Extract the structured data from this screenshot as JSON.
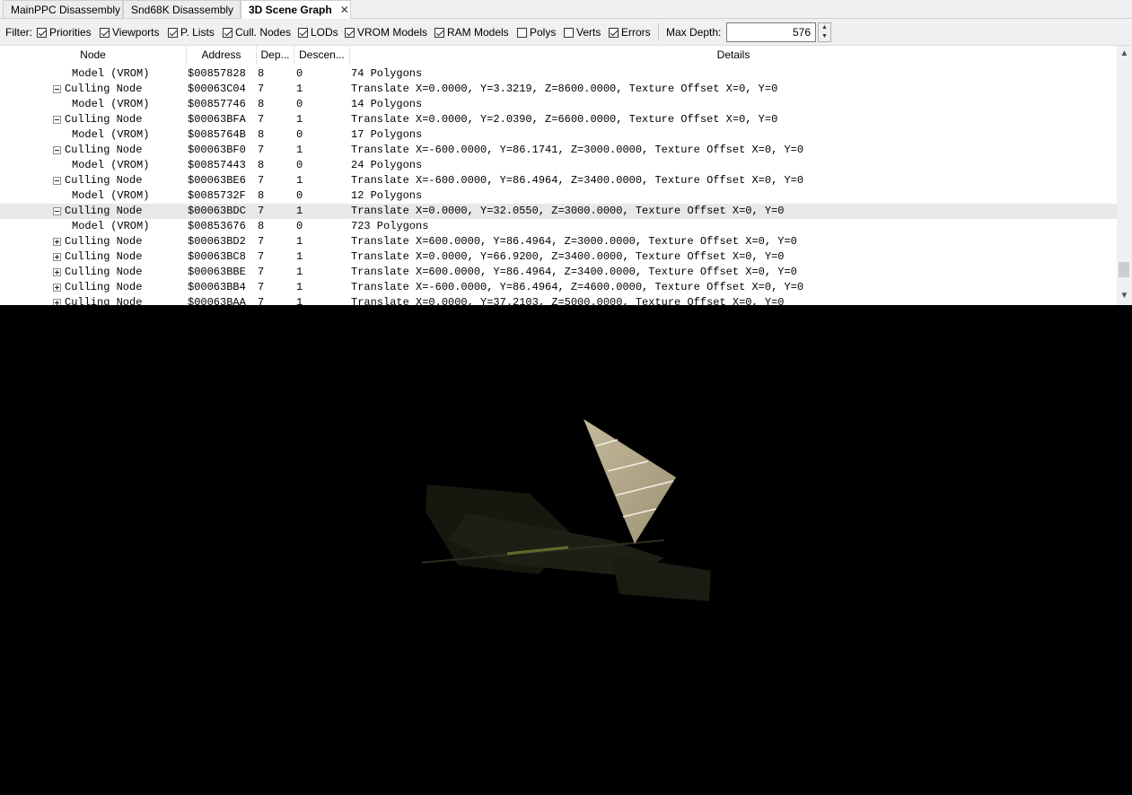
{
  "tabs": [
    {
      "label": "MainPPC Disassembly"
    },
    {
      "label": "Snd68K Disassembly"
    },
    {
      "label": "3D Scene Graph",
      "close": "✕"
    }
  ],
  "filter": {
    "label": "Filter:",
    "checks": [
      {
        "label": "Priorities",
        "checked": true
      },
      {
        "label": "Viewports",
        "checked": true
      },
      {
        "label": "P. Lists",
        "checked": true
      },
      {
        "label": "Cull. Nodes",
        "checked": true
      },
      {
        "label": "LODs",
        "checked": true
      },
      {
        "label": "VROM Models",
        "checked": true
      },
      {
        "label": "RAM Models",
        "checked": true
      },
      {
        "label": "Polys",
        "checked": false
      },
      {
        "label": "Verts",
        "checked": false
      },
      {
        "label": "Errors",
        "checked": true
      }
    ],
    "max_depth_label": "Max Depth:",
    "max_depth_value": "576"
  },
  "tree": {
    "columns": [
      "Node",
      "Address",
      "Dep...",
      "Descen...",
      "Details"
    ],
    "rows": [
      {
        "node": "Model (VROM)",
        "address": "$00857828",
        "depth": "8",
        "desc": "0",
        "details": "74 Polygons"
      },
      {
        "node": "Culling Node",
        "address": "$00063C04",
        "depth": "7",
        "desc": "1",
        "details": "Translate X=0.0000, Y=3.3219, Z=8600.0000, Texture Offset X=0, Y=0"
      },
      {
        "node": "Model (VROM)",
        "address": "$00857746",
        "depth": "8",
        "desc": "0",
        "details": "14 Polygons"
      },
      {
        "node": "Culling Node",
        "address": "$00063BFA",
        "depth": "7",
        "desc": "1",
        "details": "Translate X=0.0000, Y=2.0390, Z=6600.0000, Texture Offset X=0, Y=0"
      },
      {
        "node": "Model (VROM)",
        "address": "$0085764B",
        "depth": "8",
        "desc": "0",
        "details": "17 Polygons"
      },
      {
        "node": "Culling Node",
        "address": "$00063BF0",
        "depth": "7",
        "desc": "1",
        "details": "Translate X=-600.0000, Y=86.1741, Z=3000.0000, Texture Offset X=0, Y=0"
      },
      {
        "node": "Model (VROM)",
        "address": "$00857443",
        "depth": "8",
        "desc": "0",
        "details": "24 Polygons"
      },
      {
        "node": "Culling Node",
        "address": "$00063BE6",
        "depth": "7",
        "desc": "1",
        "details": "Translate X=-600.0000, Y=86.4964, Z=3400.0000, Texture Offset X=0, Y=0"
      },
      {
        "node": "Model (VROM)",
        "address": "$0085732F",
        "depth": "8",
        "desc": "0",
        "details": "12 Polygons"
      },
      {
        "node": "Culling Node",
        "address": "$00063BDC",
        "depth": "7",
        "desc": "1",
        "details": "Translate X=0.0000, Y=32.0550, Z=3000.0000, Texture Offset X=0, Y=0",
        "selected": true
      },
      {
        "node": "Model (VROM)",
        "address": "$00853676",
        "depth": "8",
        "desc": "0",
        "details": "723 Polygons"
      },
      {
        "node": "Culling Node",
        "address": "$00063BD2",
        "depth": "7",
        "desc": "1",
        "details": "Translate X=600.0000, Y=86.4964, Z=3000.0000, Texture Offset X=0, Y=0"
      },
      {
        "node": "Culling Node",
        "address": "$00063BC8",
        "depth": "7",
        "desc": "1",
        "details": "Translate X=0.0000, Y=66.9200, Z=3400.0000, Texture Offset X=0, Y=0"
      },
      {
        "node": "Culling Node",
        "address": "$00063BBE",
        "depth": "7",
        "desc": "1",
        "details": "Translate X=600.0000, Y=86.4964, Z=3400.0000, Texture Offset X=0, Y=0"
      },
      {
        "node": "Culling Node",
        "address": "$00063BB4",
        "depth": "7",
        "desc": "1",
        "details": "Translate X=-600.0000, Y=86.4964, Z=4600.0000, Texture Offset X=0, Y=0"
      },
      {
        "node": "Culling Node",
        "address": "$00063BAA",
        "depth": "7",
        "desc": "1",
        "details": "Translate X=0.0000, Y=37.2103, Z=5000.0000, Texture Offset X=0, Y=0"
      }
    ]
  },
  "scrollbar": {
    "up": "▲",
    "down": "▼"
  },
  "colors": {
    "viewport_bg": "#000000",
    "selected_row": "#e8e8e8",
    "sail": "#b7aa8a"
  }
}
